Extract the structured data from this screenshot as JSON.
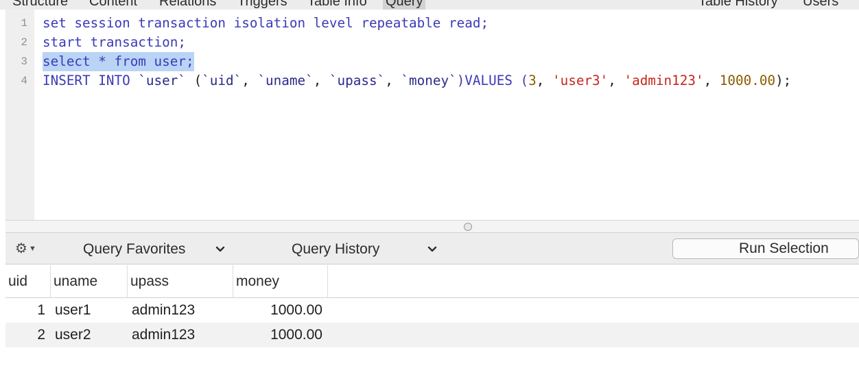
{
  "tabs": [
    "Structure",
    "Content",
    "Relations",
    "Triggers",
    "Table Info",
    "Query",
    "Table History",
    "Users"
  ],
  "editor": {
    "line_numbers": [
      "1",
      "2",
      "3",
      "4"
    ],
    "line1": "set session transaction isolation level repeatable read;",
    "line2": "start transaction;",
    "line3": "select * from user;",
    "line4": {
      "kw1": "INSERT INTO",
      "tbl": "`user`",
      "open": " (",
      "c1": "`uid`",
      "c2": "`uname`",
      "c3": "`upass`",
      "c4": "`money`",
      "values": ")VALUES (",
      "v1": "3",
      "v2": "'user3'",
      "v3": "'admin123'",
      "v4": "1000.00",
      "end": ");"
    }
  },
  "toolbar": {
    "gear_icon": "gear-icon",
    "favorites_label": "Query Favorites",
    "history_label": "Query History",
    "run_label": "Run Selection"
  },
  "results": {
    "columns": [
      "uid",
      "uname",
      "upass",
      "money"
    ],
    "rows": [
      [
        "1",
        "user1",
        "admin123",
        "1000.00"
      ],
      [
        "2",
        "user2",
        "admin123",
        "1000.00"
      ]
    ]
  }
}
